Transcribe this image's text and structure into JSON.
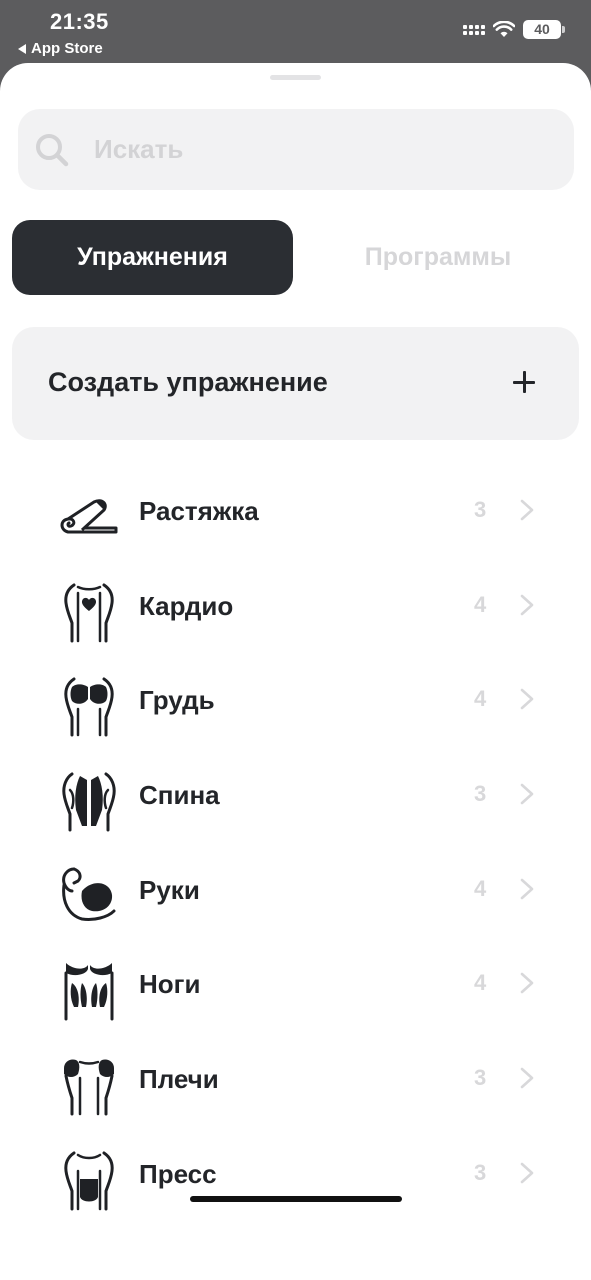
{
  "status": {
    "time": "21:35",
    "back_label": "App Store",
    "battery": "40"
  },
  "search": {
    "placeholder": "Искать"
  },
  "tabs": [
    {
      "label": "Упражнения",
      "active": true
    },
    {
      "label": "Программы",
      "active": false
    }
  ],
  "create": {
    "label": "Создать упражнение"
  },
  "categories": [
    {
      "label": "Растяжка",
      "count": "3",
      "icon": "yoga-mat-icon"
    },
    {
      "label": "Кардио",
      "count": "4",
      "icon": "heart-torso-icon"
    },
    {
      "label": "Грудь",
      "count": "4",
      "icon": "chest-icon"
    },
    {
      "label": "Спина",
      "count": "3",
      "icon": "back-icon"
    },
    {
      "label": "Руки",
      "count": "4",
      "icon": "arm-icon"
    },
    {
      "label": "Ноги",
      "count": "4",
      "icon": "legs-icon"
    },
    {
      "label": "Плечи",
      "count": "3",
      "icon": "shoulders-icon"
    },
    {
      "label": "Пресс",
      "count": "3",
      "icon": "abs-icon"
    }
  ],
  "colors": {
    "dark": "#2b2e33",
    "muted": "#d8d8da",
    "surface": "#f2f2f3"
  }
}
